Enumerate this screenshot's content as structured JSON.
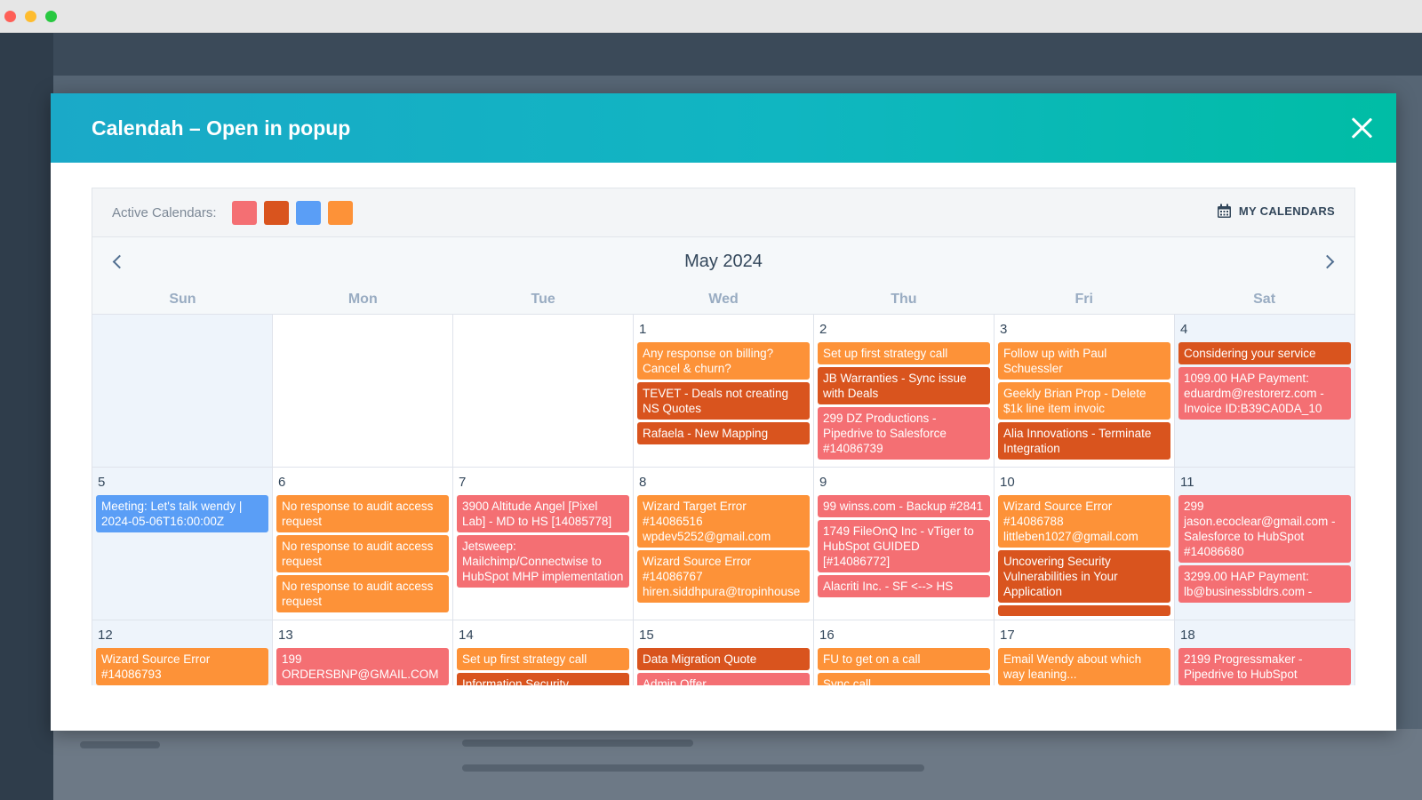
{
  "modal": {
    "title": "Calendah – Open in popup"
  },
  "toolbar": {
    "active_label": "Active Calendars:",
    "swatches": [
      "#f46f73",
      "#d9541e",
      "#5a9ef6",
      "#fd9238"
    ],
    "my_calendars_label": "MY CALENDARS"
  },
  "calendar": {
    "month_label": "May 2024",
    "weekdays": [
      "Sun",
      "Mon",
      "Tue",
      "Wed",
      "Thu",
      "Fri",
      "Sat"
    ],
    "weeks": [
      [
        {
          "day": "",
          "events": []
        },
        {
          "day": "",
          "events": []
        },
        {
          "day": "",
          "events": []
        },
        {
          "day": "1",
          "events": [
            {
              "text": "Any response on billing? Cancel & churn?",
              "color": "orange"
            },
            {
              "text": "TEVET - Deals not creating NS Quotes",
              "color": "dorange"
            },
            {
              "text": "Rafaela - New Mapping",
              "color": "dorange"
            }
          ]
        },
        {
          "day": "2",
          "events": [
            {
              "text": "Set up first strategy call",
              "color": "orange"
            },
            {
              "text": "JB Warranties - Sync issue with Deals",
              "color": "dorange"
            },
            {
              "text": "299 DZ Productions - Pipedrive to Salesforce #14086739",
              "color": "red"
            }
          ]
        },
        {
          "day": "3",
          "events": [
            {
              "text": "Follow up with Paul Schuessler",
              "color": "orange"
            },
            {
              "text": "Geekly Brian Prop - Delete $1k line item invoic",
              "color": "orange"
            },
            {
              "text": "Alia Innovations - Terminate Integration",
              "color": "dorange"
            }
          ]
        },
        {
          "day": "4",
          "events": [
            {
              "text": "Considering your service",
              "color": "dorange"
            },
            {
              "text": "1099.00 HAP Payment: eduardm@restorerz.com - Invoice ID:B39CA0DA_10",
              "color": "red"
            }
          ]
        }
      ],
      [
        {
          "day": "5",
          "events": [
            {
              "text": "Meeting: Let's talk wendy | 2024-05-06T16:00:00Z",
              "color": "blue"
            }
          ]
        },
        {
          "day": "6",
          "events": [
            {
              "text": "No response to audit access request",
              "color": "orange"
            },
            {
              "text": "No response to audit access request",
              "color": "orange"
            },
            {
              "text": "No response to audit access request",
              "color": "orange"
            }
          ]
        },
        {
          "day": "7",
          "events": [
            {
              "text": "3900 Altitude Angel [Pixel Lab] - MD to HS [14085778]",
              "color": "red"
            },
            {
              "text": "Jetsweep: Mailchimp/Connectwise to HubSpot MHP implementation",
              "color": "red"
            }
          ]
        },
        {
          "day": "8",
          "events": [
            {
              "text": "Wizard Target Error #14086516 wpdev5252@gmail.com",
              "color": "orange"
            },
            {
              "text": "Wizard Source Error #14086767 hiren.siddhpura@tropinhouse",
              "color": "orange"
            }
          ]
        },
        {
          "day": "9",
          "events": [
            {
              "text": "99 winss.com - Backup #2841",
              "color": "red"
            },
            {
              "text": "1749 FileOnQ Inc - vTiger to HubSpot GUIDED [#14086772]",
              "color": "red"
            },
            {
              "text": "Alacriti Inc. - SF <--> HS",
              "color": "red"
            }
          ]
        },
        {
          "day": "10",
          "events": [
            {
              "text": "Wizard Source Error #14086788 littleben1027@gmail.com",
              "color": "orange"
            },
            {
              "text": "Uncovering Security Vulnerabilities in Your Application",
              "color": "dorange"
            },
            {
              "text": "",
              "color": "dorange"
            }
          ]
        },
        {
          "day": "11",
          "events": [
            {
              "text": "299 jason.ecoclear@gmail.com - Salesforce to HubSpot #14086680",
              "color": "red"
            },
            {
              "text": "3299.00 HAP Payment: lb@businessbldrs.com -",
              "color": "red"
            }
          ]
        }
      ],
      [
        {
          "day": "12",
          "events": [
            {
              "text": "Wizard Source Error #14086793",
              "color": "orange"
            }
          ]
        },
        {
          "day": "13",
          "events": [
            {
              "text": "199 ORDERSBNP@GMAIL.COM",
              "color": "red"
            }
          ]
        },
        {
          "day": "14",
          "events": [
            {
              "text": "Set up first strategy call",
              "color": "orange"
            },
            {
              "text": "Information Security",
              "color": "dorange"
            }
          ]
        },
        {
          "day": "15",
          "events": [
            {
              "text": "Data Migration Quote",
              "color": "dorange"
            },
            {
              "text": "Admin Offer",
              "color": "red"
            }
          ]
        },
        {
          "day": "16",
          "events": [
            {
              "text": "FU to get on a call",
              "color": "orange"
            },
            {
              "text": "Sync call",
              "color": "orange"
            }
          ]
        },
        {
          "day": "17",
          "events": [
            {
              "text": "Email Wendy about which way leaning...",
              "color": "orange"
            }
          ]
        },
        {
          "day": "18",
          "events": [
            {
              "text": "2199 Progressmaker - Pipedrive to HubSpot",
              "color": "red"
            }
          ]
        }
      ]
    ]
  }
}
